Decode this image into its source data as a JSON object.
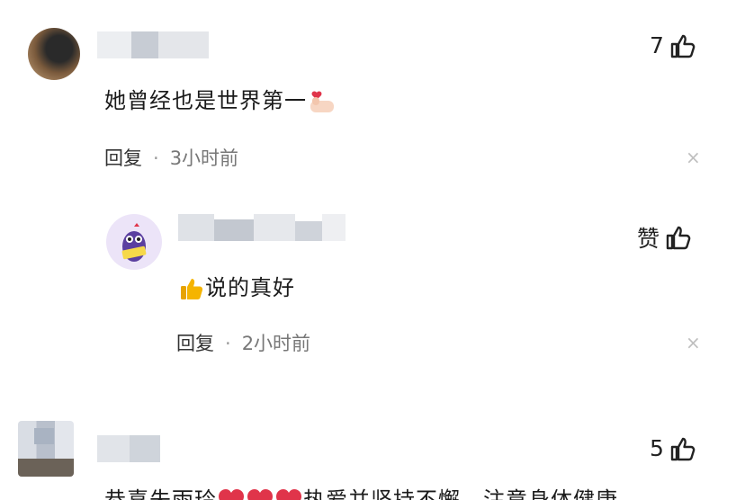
{
  "comments": [
    {
      "text": "她曾经也是世界第一",
      "reply_label": "回复",
      "separator": "·",
      "time": "3小时前",
      "like_count": "7",
      "close_glyph": "×"
    },
    {
      "text": "说的真好",
      "reply_label": "回复",
      "separator": "·",
      "time": "2小时前",
      "like_label": "赞",
      "close_glyph": "×"
    },
    {
      "text_part1": "恭喜朱雨玲",
      "text_part2": "热爱并坚持不懈，注意身体健康",
      "like_count": "5"
    }
  ],
  "icons": {
    "like": "thumbs-up-outline-icon",
    "emoji_finger_heart": "finger-heart-emoji",
    "emoji_thumbs_up": "thumbs-up-emoji",
    "emoji_heart": "heart-emoji"
  },
  "colors": {
    "text": "#1b1b1b",
    "meta_time": "#777777",
    "close": "#bfbfbf",
    "heart": "#e0344a",
    "thumb_emoji": "#f5b400"
  }
}
